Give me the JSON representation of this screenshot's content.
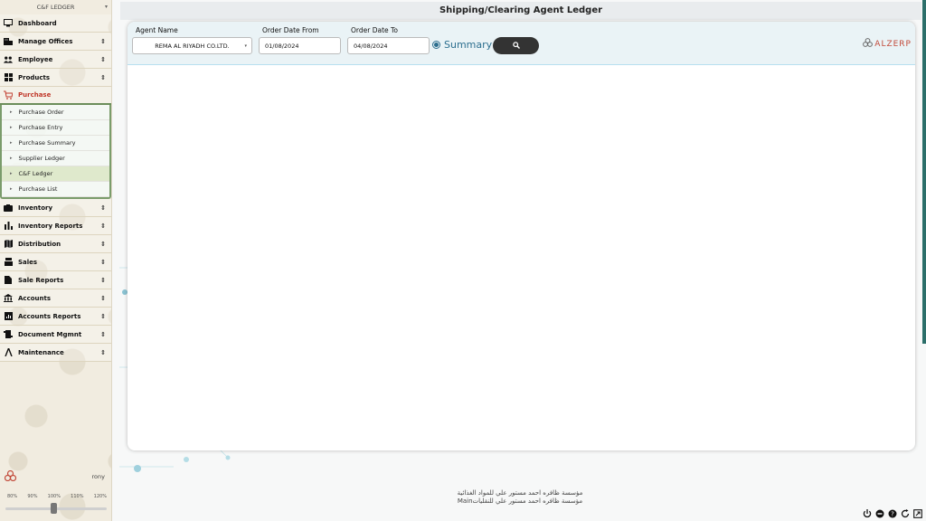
{
  "sidebar": {
    "header": "C&F LEDGER",
    "menu": [
      {
        "label": "Dashboard",
        "icon": "monitor-icon",
        "arrow": ""
      },
      {
        "label": "Manage Offices",
        "icon": "office-icon",
        "arrow": "⇕"
      },
      {
        "label": "Employee",
        "icon": "users-icon",
        "arrow": "⇕"
      },
      {
        "label": "Products",
        "icon": "grid-icon",
        "arrow": "⇕"
      },
      {
        "label": "Purchase",
        "icon": "cart-icon",
        "arrow": ""
      }
    ],
    "purchase_sub": [
      "Purchase Order",
      "Purchase Entry",
      "Purchase Summary",
      "Supplier Ledger",
      "C&F Ledger",
      "Purchase List"
    ],
    "menu2": [
      {
        "label": "Inventory",
        "icon": "box-icon"
      },
      {
        "label": "Inventory Reports",
        "icon": "bar-chart-icon"
      },
      {
        "label": "Distribution",
        "icon": "map-icon"
      },
      {
        "label": "Sales",
        "icon": "register-icon"
      },
      {
        "label": "Sale Reports",
        "icon": "report-icon"
      },
      {
        "label": "Accounts",
        "icon": "bank-icon"
      },
      {
        "label": "Accounts Reports",
        "icon": "accounts-report-icon"
      },
      {
        "label": "Document Mgmnt",
        "icon": "document-icon"
      },
      {
        "label": "Maintenance",
        "icon": "tool-icon"
      }
    ],
    "user": "rony",
    "zoom_levels": [
      "80%",
      "90%",
      "100%",
      "110%",
      "120%"
    ],
    "zoom_value": "100%"
  },
  "page": {
    "title": "Shipping/Clearing Agent Ledger"
  },
  "filters": {
    "agent_label": "Agent Name",
    "agent_value": "REMA AL RIYADH CO.LTD.",
    "from_label": "Order Date From",
    "from_value": "01/08/2024",
    "to_label": "Order Date To",
    "to_value": "04/08/2024",
    "summary_label": "Summary",
    "brand": "ALZERP"
  },
  "footer": {
    "line1": "مؤسسة ظافره احمد مستور علي للمواد الغذائية",
    "line2": "Mainمؤسسة ظافره احمد مستور علي للنقليات"
  },
  "colors": {
    "accent": "#2d6f8f",
    "brand": "#c24a3a",
    "active": "#c0392b",
    "sub_border": "#7a9c6b"
  }
}
